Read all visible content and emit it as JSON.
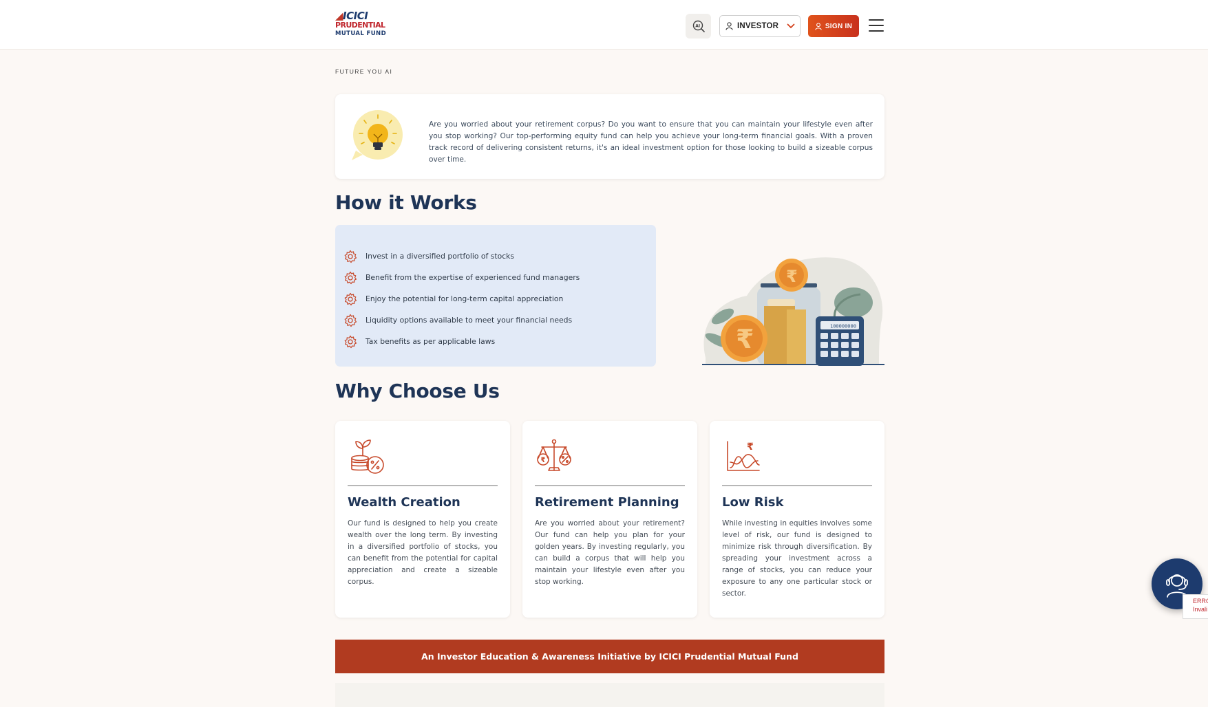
{
  "header": {
    "logo": {
      "line1": "ICICI",
      "line2": "PRUDENTIAL",
      "line3": "MUTUAL FUND"
    },
    "ai_icon": "ai-search-icon",
    "investor_label": "INVESTOR",
    "signin_label": "SIGN IN",
    "menu_icon": "hamburger-menu-icon",
    "accent_color": "#d3411c"
  },
  "breadcrumb": "FUTURE YOU AI",
  "intro": {
    "icon": "lightbulb-icon",
    "text": "Are you worried about your retirement corpus? Do you want to ensure that you can maintain your lifestyle even after you stop working? Our top-performing equity fund can help you achieve your long-term financial goals. With a proven track record of delivering consistent returns, it's an ideal investment option for those looking to build a sizeable corpus over time."
  },
  "how_it_works": {
    "heading": "How it Works",
    "items": [
      "Invest in a diversified portfolio of stocks",
      "Benefit from the expertise of experienced fund managers",
      "Enjoy the potential for long-term capital appreciation",
      "Liquidity options available to meet your financial needs",
      "Tax benefits as per applicable laws"
    ],
    "calculator_display": "100000000"
  },
  "why_choose_us": {
    "heading": "Why Choose Us",
    "cards": [
      {
        "icon": "plant-coins-percent-icon",
        "title": "Wealth Creation",
        "text": "Our fund is designed to help you create wealth over the long term. By investing in a diversified portfolio of stocks, you can benefit from the potential for capital appreciation and create a sizeable corpus."
      },
      {
        "icon": "balance-scale-icon",
        "title": "Retirement Planning",
        "text": "Are you worried about your retirement? Our fund can help you plan for your golden years. By investing regularly, you can build a corpus that will help you maintain your lifestyle even after you stop working."
      },
      {
        "icon": "rupee-chart-icon",
        "title": "Low Risk",
        "text": "While investing in equities involves some level of risk, our fund is designed to minimize risk through diversification. By spreading your investment across a range of stocks, you can reduce your exposure to any one particular stock or sector."
      }
    ]
  },
  "banner": "An Investor Education & Awareness Initiative by ICICI Prudential Mutual Fund",
  "chat_icon": "support-agent-icon",
  "recaptcha_text": "ERRO Invali"
}
